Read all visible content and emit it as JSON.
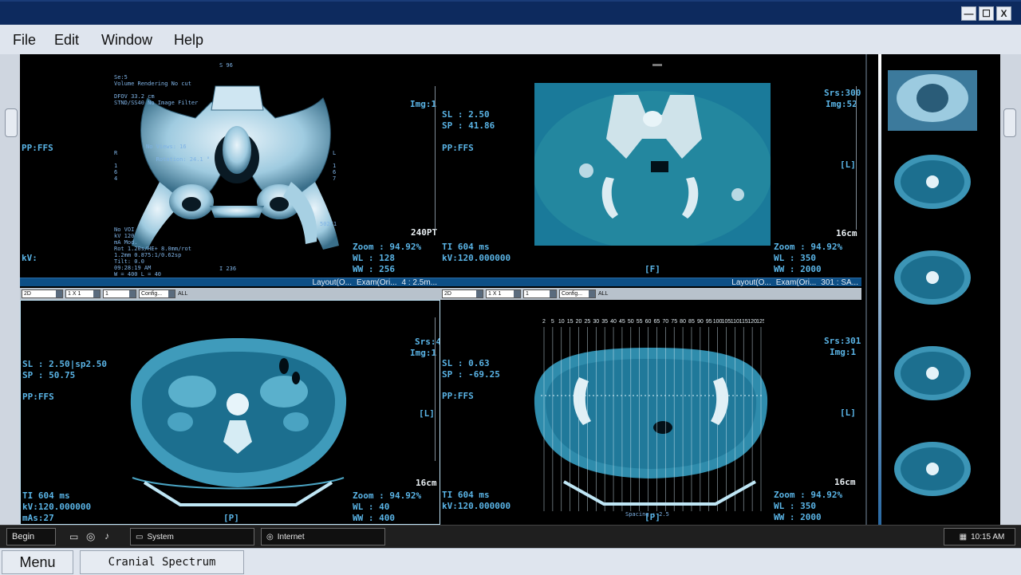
{
  "window": {
    "minimize": "—",
    "maximize": "☐",
    "close": "X"
  },
  "menu": {
    "file": "File",
    "edit": "Edit",
    "window": "Window",
    "help": "Help"
  },
  "viewports": {
    "tl": {
      "top": "S 96",
      "info": "Se:5\nVolume Rendering No cut\n\nDFOV 33.2 cm\nSTND/SS40 No Image Filter",
      "mid": "No Views: 16\n\n   Rotation: 24.1 °",
      "left_r": "R\n\n1\n6\n4",
      "right_l": "L\n\n1\n6\n7",
      "lower": "No VOI\nkV 120\nmA Mod.\nRot 1.20s/HE+ 8.0mm/rot\n1.2mm 0.875:1/0.62sp\nTilt: 0.0\n09:28:19 AM\nW = 400 L = 40",
      "bottom": "I 236",
      "code": "502/1",
      "pp": "PP:FFS",
      "kv": "kV:",
      "img": "Img:1",
      "pt": "240PT",
      "zoom": "Zoom : 94.92%",
      "wl": "WL : 128",
      "ww": "WW : 256"
    },
    "tr": {
      "sl": "SL : 2.50",
      "sp": "SP : 41.86",
      "pp": "PP:FFS",
      "srs": "Srs:300",
      "img": "Img:52",
      "side": "[L]",
      "scale": "16cm",
      "ti": "TI 604 ms",
      "kv": "kV:120.000000",
      "orient": "[F]",
      "zoom": "Zoom : 94.92%",
      "wl": "WL : 350",
      "ww": "WW : 2000"
    },
    "bl": {
      "sl": "SL : 2.50|sp2.50",
      "sp": "SP : 50.75",
      "pp": "PP:FFS",
      "srs": "Srs:4",
      "img": "Img:1",
      "side": "[L]",
      "scale": "16cm",
      "ti": "TI 604 ms",
      "kv": "kV:120.000000",
      "mas": "mAs:27",
      "orient": "[P]",
      "zoom": "Zoom : 94.92%",
      "wl": "WL : 40",
      "ww": "WW : 400"
    },
    "br": {
      "sl": "SL : 0.63",
      "sp": "SP : -69.25",
      "pp": "PP:FFS",
      "srs": "Srs:301",
      "img": "Img:1",
      "side": "[L]",
      "scale": "16cm",
      "ti": "TI 604 ms",
      "kv": "kV:120.000000",
      "orient": "[P]",
      "zoom": "Zoom : 94.92%",
      "wl": "WL : 350",
      "ww": "WW : 2000",
      "spacing": "Spacing : 2.5",
      "ruler": [
        "2",
        "5",
        "10",
        "15",
        "20",
        "25",
        "30",
        "35",
        "40",
        "45",
        "50",
        "55",
        "60",
        "65",
        "70",
        "75",
        "80",
        "85",
        "90",
        "95",
        "100",
        "105",
        "110",
        "115",
        "120",
        "125"
      ]
    }
  },
  "toolbar_left": {
    "layout": "Layout(O...",
    "exam": "Exam(Ori...",
    "series": "4 : 2.5m..."
  },
  "toolbar_right": {
    "layout": "Layout(O...",
    "exam": "Exam(Ori...",
    "series": "301 : SA..."
  },
  "toolbar2_left": {
    "mode": "2D",
    "grid": "1 X 1",
    "num": "1",
    "config": "Config...",
    "all": "ALL"
  },
  "toolbar2_right": {
    "mode": "2D",
    "grid": "1 X 1",
    "num": "1",
    "config": "Config...",
    "all": "ALL"
  },
  "taskbar": {
    "begin": "Begin",
    "system": "System",
    "internet": "Internet",
    "clock": "10:15 AM"
  },
  "bottom": {
    "menu": "Menu",
    "app": "Cranial Spectrum"
  },
  "colors": {
    "accent": "#5ab4e6",
    "titlebar": "#0d2a5e",
    "toolbar": "#0d4f86"
  }
}
